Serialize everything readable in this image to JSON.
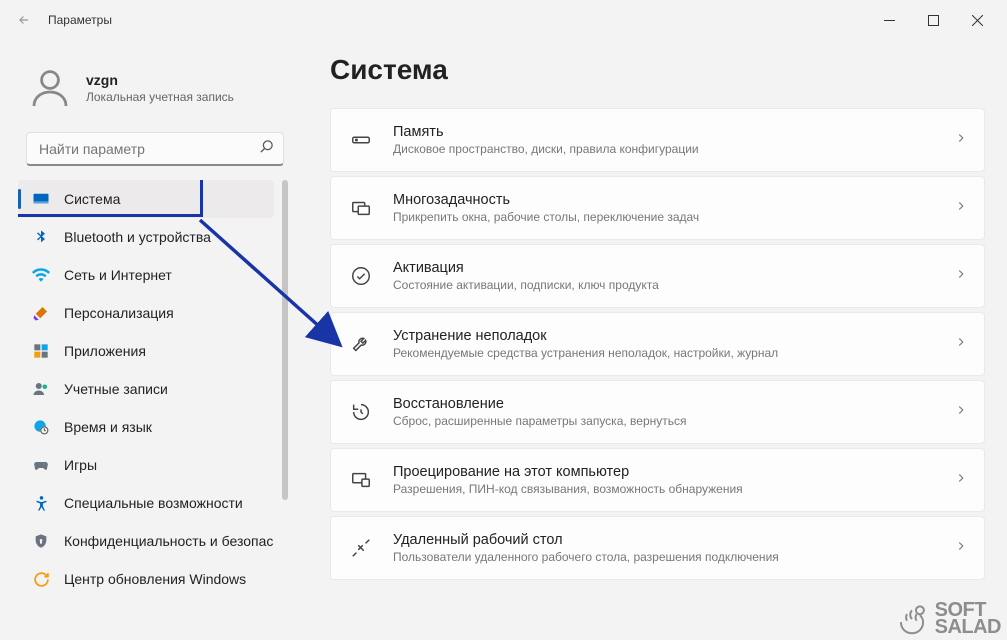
{
  "window": {
    "title": "Параметры"
  },
  "profile": {
    "name": "vzgn",
    "subtitle": "Локальная учетная запись"
  },
  "search": {
    "placeholder": "Найти параметр"
  },
  "nav": [
    {
      "id": "system",
      "label": "Система",
      "selected": true
    },
    {
      "id": "bluetooth",
      "label": "Bluetooth и устройства",
      "selected": false
    },
    {
      "id": "network",
      "label": "Сеть и Интернет",
      "selected": false
    },
    {
      "id": "personalization",
      "label": "Персонализация",
      "selected": false
    },
    {
      "id": "apps",
      "label": "Приложения",
      "selected": false
    },
    {
      "id": "accounts",
      "label": "Учетные записи",
      "selected": false
    },
    {
      "id": "time",
      "label": "Время и язык",
      "selected": false
    },
    {
      "id": "gaming",
      "label": "Игры",
      "selected": false
    },
    {
      "id": "accessibility",
      "label": "Специальные возможности",
      "selected": false
    },
    {
      "id": "privacy",
      "label": "Конфиденциальность и безопасность",
      "selected": false
    },
    {
      "id": "update",
      "label": "Центр обновления Windows",
      "selected": false
    }
  ],
  "main": {
    "heading": "Система",
    "items": [
      {
        "id": "storage",
        "title": "Память",
        "sub": "Дисковое пространство, диски, правила конфигурации"
      },
      {
        "id": "multitask",
        "title": "Многозадачность",
        "sub": "Прикрепить окна, рабочие столы, переключение задач"
      },
      {
        "id": "activation",
        "title": "Активация",
        "sub": "Состояние активации, подписки, ключ продукта"
      },
      {
        "id": "troubleshoot",
        "title": "Устранение неполадок",
        "sub": "Рекомендуемые средства устранения неполадок, настройки, журнал"
      },
      {
        "id": "recovery",
        "title": "Восстановление",
        "sub": "Сброс, расширенные параметры запуска, вернуться"
      },
      {
        "id": "projecting",
        "title": "Проецирование на этот компьютер",
        "sub": "Разрешения, ПИН-код связывания, возможность обнаружения"
      },
      {
        "id": "remote",
        "title": "Удаленный рабочий стол",
        "sub": "Пользователи удаленного рабочего стола, разрешения подключения"
      }
    ]
  },
  "watermark": {
    "line1": "SOFT",
    "line2": "SALAD"
  }
}
